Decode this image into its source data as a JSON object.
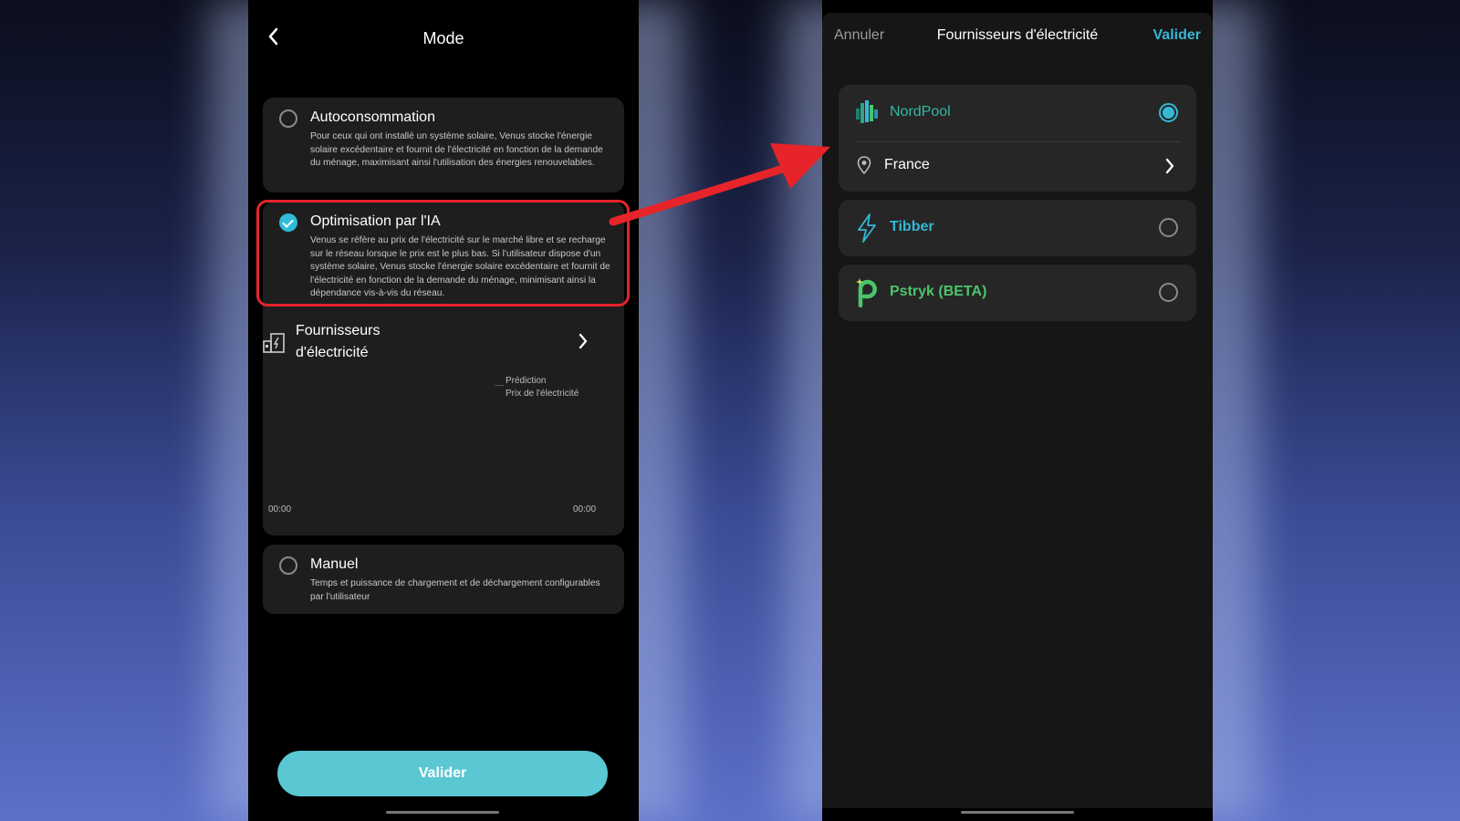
{
  "left": {
    "title": "Mode",
    "options": [
      {
        "title": "Autoconsommation",
        "description": "Pour ceux qui ont installé un système solaire, Venus stocke l'énergie solaire excédentaire et fournit de l'électricité en fonction de la demande du ménage, maximisant ainsi l'utilisation des énergies renouvelables.",
        "selected": false
      },
      {
        "title": "Optimisation par l'IA",
        "description": "Venus se réfère au prix de l'électricité sur le marché libre et se recharge sur le réseau lorsque le prix est le plus bas. Si l'utilisateur dispose d'un système solaire, Venus stocke l'énergie solaire excédentaire et fournit de l'électricité en fonction de la demande du ménage, minimisant ainsi la dépendance vis-à-vis du réseau.",
        "selected": true
      },
      {
        "title": "Manuel",
        "description": "Temps et puissance de chargement et de déchargement configurables par l'utilisateur",
        "selected": false
      }
    ],
    "providers": {
      "label_line1": "Fournisseurs",
      "label_line2": "d'électricité",
      "legend_prediction": "Prédiction",
      "legend_price": "Prix de l'électricité",
      "x_start": "00:00",
      "x_end": "00:00"
    },
    "submit_label": "Valider"
  },
  "right": {
    "cancel_label": "Annuler",
    "title": "Fournisseurs d'électricité",
    "confirm_label": "Valider",
    "providers": [
      {
        "name": "NordPool",
        "selected": true,
        "color": "#35b8a0",
        "region": "France"
      },
      {
        "name": "Tibber",
        "selected": false,
        "color": "#35b8d6"
      },
      {
        "name": "Pstryk (BETA)",
        "selected": false,
        "color": "#4cc56a"
      }
    ]
  },
  "colors": {
    "accent": "#35b8d6",
    "submit_button": "#5ac7d3",
    "highlight_annotation": "#e6242a"
  }
}
